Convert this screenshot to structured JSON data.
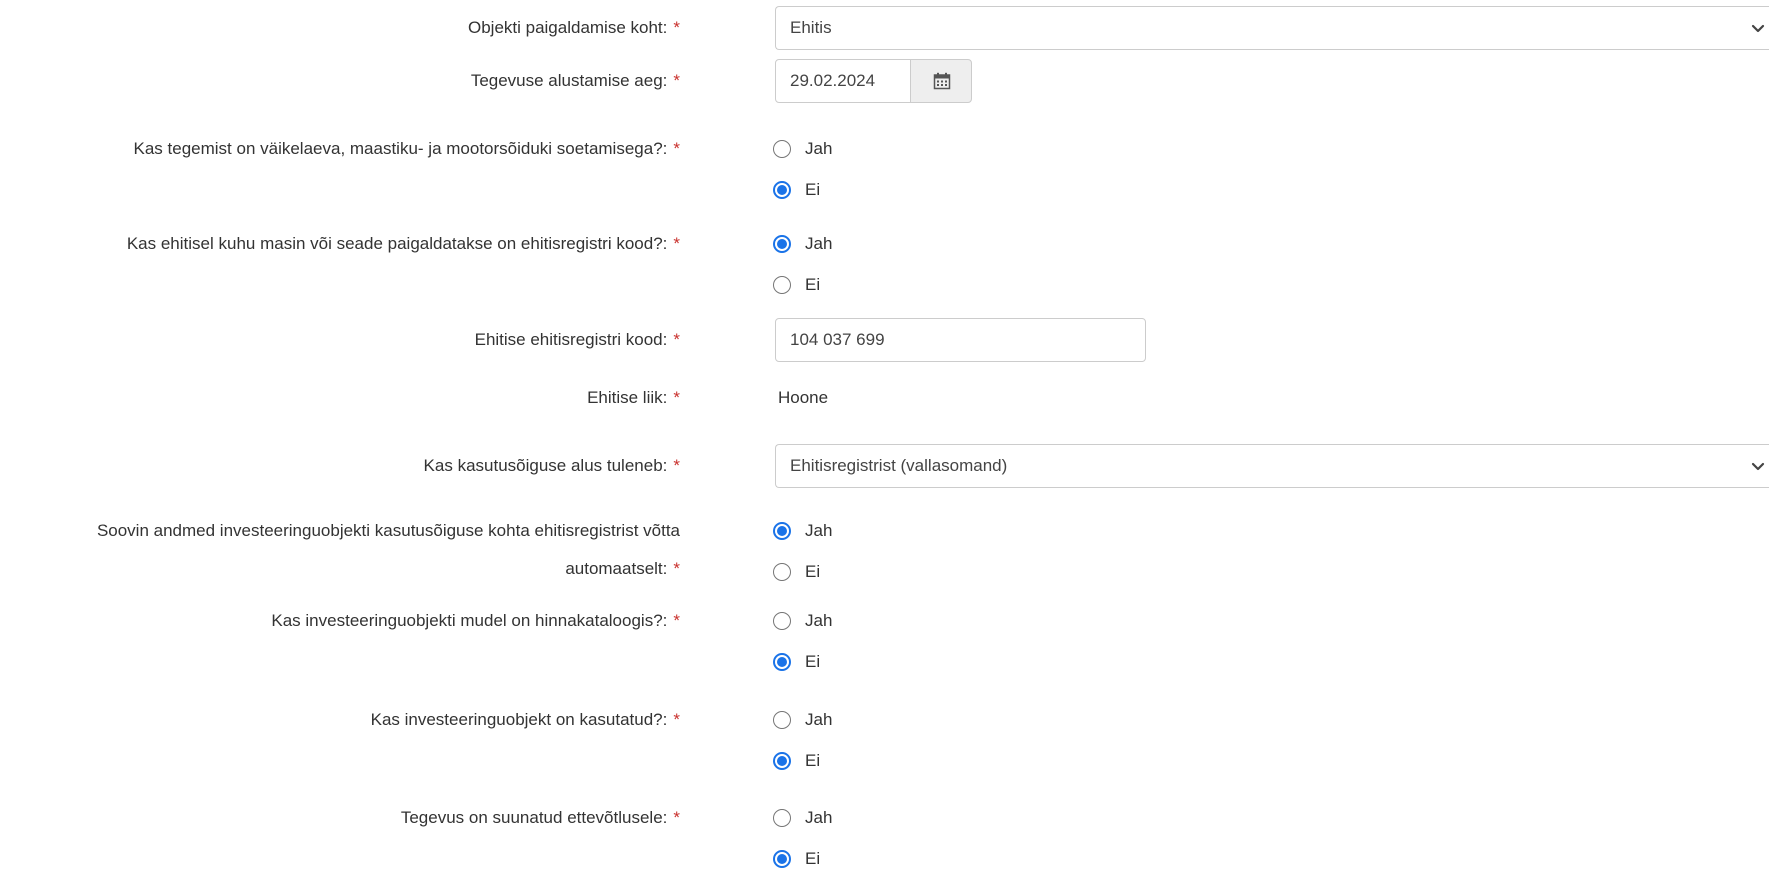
{
  "form": {
    "required_mark": "*",
    "install_location": {
      "label": "Objekti paigaldamise koht:",
      "value": "Ehitis"
    },
    "start_date": {
      "label": "Tegevuse alustamise aeg:",
      "value": "29.02.2024",
      "icon": "calendar-icon"
    },
    "vehicle_purchase": {
      "label": "Kas tegemist on väikelaeva, maastiku- ja mootorsõiduki soetamisega?:",
      "options": [
        "Jah",
        "Ei"
      ],
      "selected": "Ei"
    },
    "has_registry_code": {
      "label": "Kas ehitisel kuhu masin või seade paigaldatakse on ehitisregistri kood?:",
      "options": [
        "Jah",
        "Ei"
      ],
      "selected": "Jah"
    },
    "registry_code": {
      "label": "Ehitise ehitisregistri kood:",
      "value": "104 037 699"
    },
    "building_type": {
      "label": "Ehitise liik:",
      "value": "Hoone"
    },
    "usage_right_basis": {
      "label": "Kas kasutusõiguse alus tuleneb:",
      "value": "Ehitisregistrist (vallasomand)"
    },
    "auto_fetch": {
      "label_line1": "Soovin andmed investeeringuobjekti kasutusõiguse kohta ehitisregistrist võtta",
      "label_line2": "automaatselt:",
      "options": [
        "Jah",
        "Ei"
      ],
      "selected": "Jah"
    },
    "in_price_catalog": {
      "label": "Kas investeeringuobjekti mudel on hinnakataloogis?:",
      "options": [
        "Jah",
        "Ei"
      ],
      "selected": "Ei"
    },
    "is_used": {
      "label": "Kas investeeringuobjekt on kasutatud?:",
      "options": [
        "Jah",
        "Ei"
      ],
      "selected": "Ei"
    },
    "business_directed": {
      "label": "Tegevus on suunatud ettevõtlusele:",
      "options": [
        "Jah",
        "Ei"
      ],
      "selected": "Ei"
    }
  },
  "colors": {
    "required": "#c9302c",
    "radio_checked": "#1a73e8",
    "border": "#cccccc"
  }
}
